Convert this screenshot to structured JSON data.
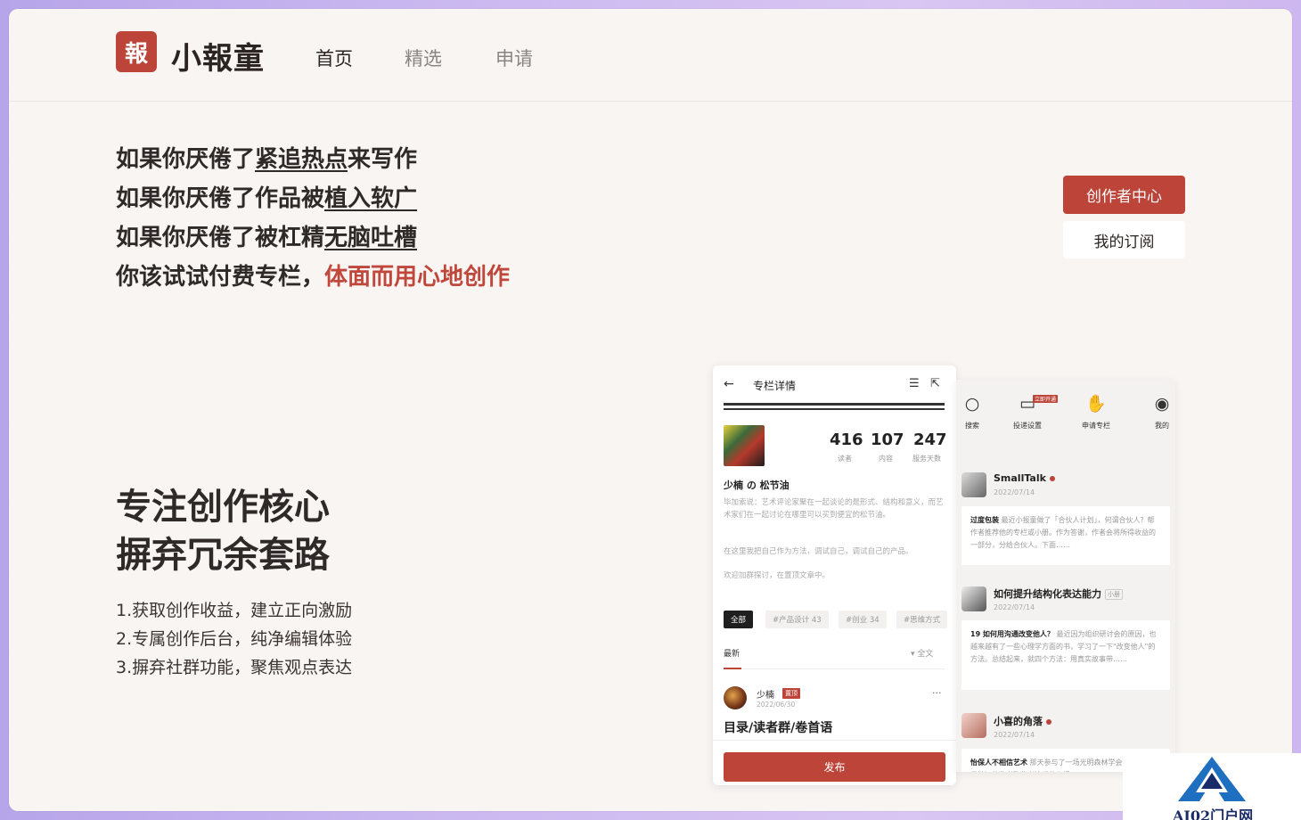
{
  "brand": {
    "logo_char": "報",
    "name": "小報童"
  },
  "nav": [
    {
      "label": "首页",
      "active": true
    },
    {
      "label": "精选",
      "active": false
    },
    {
      "label": "申请",
      "active": false
    }
  ],
  "hero": {
    "line1": {
      "pre": "如果你厌倦了",
      "u": "紧追热点",
      "post": "来写作"
    },
    "line2": {
      "pre": "如果你厌倦了作品被",
      "u": "植入软广"
    },
    "line3": {
      "pre": "如果你厌倦了被杠精",
      "u": "无脑吐槽"
    },
    "line4": {
      "pre": "你该试试付费专栏，",
      "red": "体面而用心地创作"
    }
  },
  "actions": {
    "primary": "创作者中心",
    "secondary": "我的订阅"
  },
  "section": {
    "title1": "专注创作核心",
    "title2": "摒弃冗余套路",
    "features": [
      "1.获取创作收益，建立正向激励",
      "2.专属创作后台，纯净编辑体验",
      "3.摒弃社群功能，聚焦观点表达"
    ]
  },
  "phone1": {
    "back": "←",
    "title": "专栏详情",
    "stats": [
      {
        "value": "416",
        "label": "读者"
      },
      {
        "value": "107",
        "label": "内容"
      },
      {
        "value": "247",
        "label": "服务天数"
      }
    ],
    "name": "少楠 の 松节油",
    "desc1": "毕加索说：艺术评论家聚在一起谈论的是形式、结构和意义，而艺术家们在一起讨论在哪里可以买到便宜的松节油。",
    "desc2": "在这里我把自己作为方法，调试自己，调试自己的产品。",
    "desc3": "欢迎加群探讨，在置顶文章中。",
    "tags": [
      "全部",
      "#产品设计 43",
      "#创业 34",
      "#思维方式"
    ],
    "latest": "最新",
    "full": "▾ 全文",
    "author": "少楠",
    "badge": "置顶",
    "date": "2022/06/30",
    "more": "···",
    "article": "目录/读者群/卷首语",
    "publish": "发布"
  },
  "phone2": {
    "tools": [
      {
        "icon": "search-icon",
        "glyph": "○",
        "label": "搜索"
      },
      {
        "icon": "mailbox-icon",
        "glyph": "▭",
        "label": "投递设置"
      },
      {
        "icon": "hand-icon",
        "glyph": "✋",
        "label": "申请专栏"
      },
      {
        "icon": "user-icon",
        "glyph": "◉",
        "label": "我的"
      }
    ],
    "tool_badge": "立即开通",
    "feeds": [
      {
        "name": "SmallTalk",
        "date": "2022/07/14",
        "title": "过度包装",
        "text": "最近小报童做了「合伙人计划」，何谓合伙人？帮作者推荐他的专栏或小册。作为答谢，作者会将所得收益的一部分，分给合伙人。下面……"
      },
      {
        "name": "如何提升结构化表达能力",
        "mini": "小册",
        "date": "2022/07/14",
        "title": "19 如何用沟通改变他人？",
        "text": "最近因为组织研讨会的原因，也越来越有了一些心理学方面的书，学习了一下\"改变他人\"的方法。总结起来，就四个方法：用真实故事带……"
      },
      {
        "name": "小喜的角落",
        "date": "2022/07/14",
        "title": "怡保人不相信艺术",
        "text": "那天参与了一场光明森林学会的，与《流俗地》的作者黎紫书连线的直播……"
      }
    ]
  },
  "watermark": "AI02门户网"
}
